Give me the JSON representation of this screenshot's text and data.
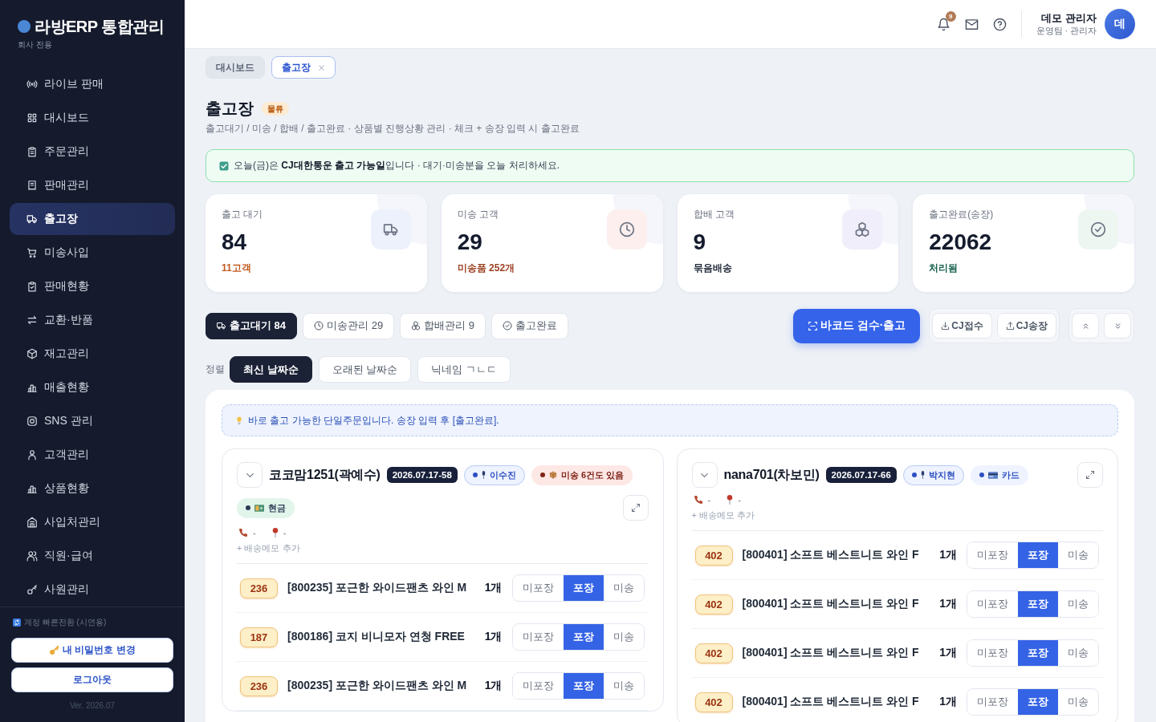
{
  "sidebar": {
    "brand": {
      "title": "라방ERP 통합관리",
      "subtitle": "회사 전용"
    },
    "items": [
      {
        "label": "라이브 판매",
        "selected": false
      },
      {
        "label": "대시보드",
        "selected": false
      },
      {
        "label": "주문관리",
        "selected": false
      },
      {
        "label": "판매관리",
        "selected": false
      },
      {
        "label": "출고장",
        "selected": true
      },
      {
        "label": "미송사입",
        "selected": false
      },
      {
        "label": "판매현황",
        "selected": false
      },
      {
        "label": "교환·반품",
        "selected": false
      },
      {
        "label": "재고관리",
        "selected": false
      },
      {
        "label": "매출현황",
        "selected": false
      },
      {
        "label": "SNS 관리",
        "selected": false
      },
      {
        "label": "고객관리",
        "selected": false
      },
      {
        "label": "상품현황",
        "selected": false
      },
      {
        "label": "사입처관리",
        "selected": false
      },
      {
        "label": "직원·급여",
        "selected": false
      },
      {
        "label": "사원관리",
        "selected": false
      }
    ],
    "footer": {
      "note": "계정 빠른전환 (시연용)",
      "buttons": [
        "내 비밀번호 변경",
        "로그아웃"
      ],
      "version": "Ver. 2026.07"
    }
  },
  "header": {
    "notification_count": "9",
    "user": {
      "name": "데모 관리자",
      "role": "운영팀 · 관리자",
      "avatar": "데"
    }
  },
  "tabs": [
    {
      "label": "대시보드",
      "selected": false,
      "closable": false
    },
    {
      "label": "출고장",
      "selected": true,
      "closable": true
    }
  ],
  "page": {
    "title": "출고장",
    "badge": "물류",
    "subtitle": "출고대기 / 미송 / 합배 / 출고완료 · 상품별 진행상황 관리 · 체크 + 송장 입력 시 출고완료"
  },
  "banner": {
    "checked": true,
    "text": "오늘(금)은 **CJ대한통운 출고 가능일**입니다 · 대기·미송분을 오늘 처리하세요."
  },
  "stats": [
    {
      "label": "출고 대기",
      "value": "84",
      "note": "11고객"
    },
    {
      "label": "미송 고객",
      "value": "29",
      "note": "미송품 252개"
    },
    {
      "label": "합배 고객",
      "value": "9",
      "note": "묶음배송"
    },
    {
      "label": "출고완료(송장)",
      "value": "22062",
      "note": "처리됨"
    }
  ],
  "filters": [
    {
      "label": "출고대기 84",
      "selected": true
    },
    {
      "label": "미송관리 29",
      "selected": false
    },
    {
      "label": "합배관리 9",
      "selected": false
    },
    {
      "label": "출고완료",
      "selected": false
    }
  ],
  "actions": {
    "primary": "바코드 검수·출고",
    "cj": [
      "CJ접수",
      "CJ송장"
    ]
  },
  "sort": {
    "label": "정렬",
    "options": [
      {
        "label": "최신 날짜순",
        "selected": true
      },
      {
        "label": "오래된 날짜순",
        "selected": false
      },
      {
        "label": "닉네임 ㄱㄴㄷ",
        "selected": false
      }
    ]
  },
  "notice": "바로 출고 가능한 단일주문입니다. 송장 입력 후 [출고완료].",
  "orders": [
    {
      "customer": "코코맘1251(곽예수)",
      "order_no": "2026.07.17-58",
      "tags": [
        {
          "kind": "staff",
          "label": "이수진"
        },
        {
          "kind": "unsent",
          "label": "미송 6건도 있음"
        },
        {
          "kind": "cash",
          "label": "현금"
        }
      ],
      "phone": "-",
      "address": "-",
      "memo_link": "+ 배송메모 추가",
      "items": [
        {
          "badge": "236",
          "name": "[800235] 포근한 와이드팬츠 와인 M",
          "quantity": "1개",
          "statuses": [
            {
              "label": "미포장",
              "selected": false
            },
            {
              "label": "포장",
              "selected": true
            },
            {
              "label": "미송",
              "selected": false
            }
          ]
        },
        {
          "badge": "187",
          "name": "[800186] 코지 비니모자 연청 FREE",
          "quantity": "1개",
          "statuses": [
            {
              "label": "미포장",
              "selected": false
            },
            {
              "label": "포장",
              "selected": true
            },
            {
              "label": "미송",
              "selected": false
            }
          ]
        },
        {
          "badge": "236",
          "name": "[800235] 포근한 와이드팬츠 와인 M",
          "quantity": "1개",
          "statuses": [
            {
              "label": "미포장",
              "selected": false
            },
            {
              "label": "포장",
              "selected": true
            },
            {
              "label": "미송",
              "selected": false
            }
          ]
        }
      ]
    },
    {
      "customer": "nana701(차보민)",
      "order_no": "2026.07.17-66",
      "tags": [
        {
          "kind": "staff",
          "label": "박지현"
        },
        {
          "kind": "card",
          "label": "카드"
        }
      ],
      "phone": "-",
      "address": "-",
      "memo_link": "+ 배송메모 추가",
      "items": [
        {
          "badge": "402",
          "name": "[800401] 소프트 베스트니트 와인 F",
          "quantity": "1개",
          "statuses": [
            {
              "label": "미포장",
              "selected": false
            },
            {
              "label": "포장",
              "selected": true
            },
            {
              "label": "미송",
              "selected": false
            }
          ]
        },
        {
          "badge": "402",
          "name": "[800401] 소프트 베스트니트 와인 F",
          "quantity": "1개",
          "statuses": [
            {
              "label": "미포장",
              "selected": false
            },
            {
              "label": "포장",
              "selected": true
            },
            {
              "label": "미송",
              "selected": false
            }
          ]
        },
        {
          "badge": "402",
          "name": "[800401] 소프트 베스트니트 와인 F",
          "quantity": "1개",
          "statuses": [
            {
              "label": "미포장",
              "selected": false
            },
            {
              "label": "포장",
              "selected": true
            },
            {
              "label": "미송",
              "selected": false
            }
          ]
        },
        {
          "badge": "402",
          "name": "[800401] 소프트 베스트니트 와인 F",
          "quantity": "1개",
          "statuses": [
            {
              "label": "미포장",
              "selected": false
            },
            {
              "label": "포장",
              "selected": true
            },
            {
              "label": "미송",
              "selected": false
            }
          ]
        }
      ]
    }
  ]
}
